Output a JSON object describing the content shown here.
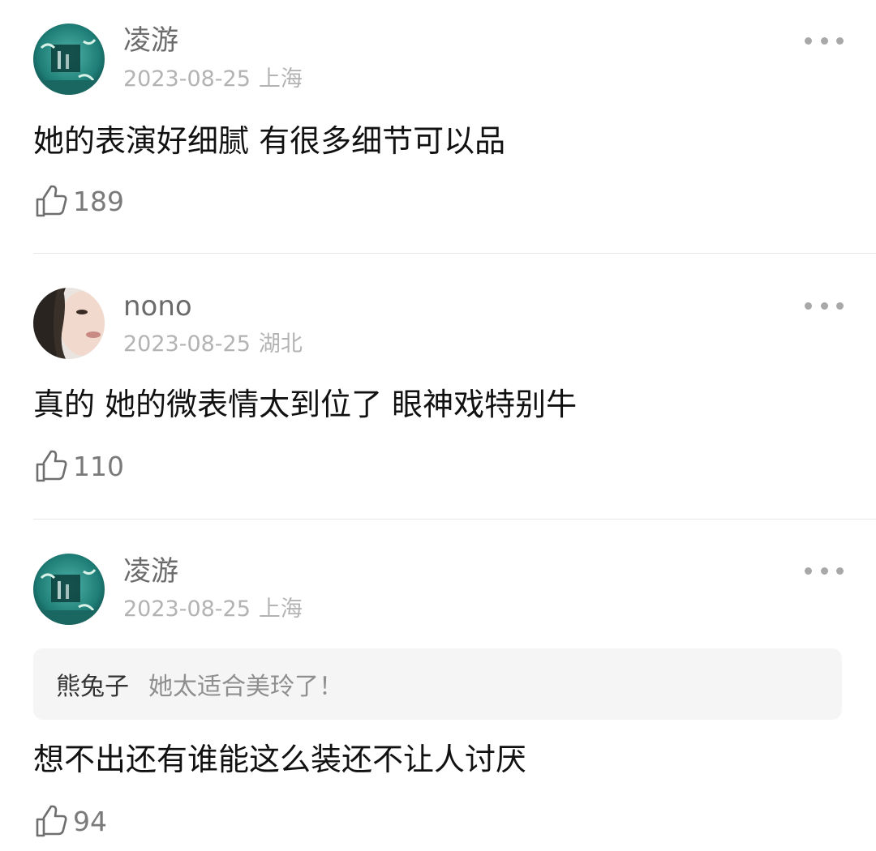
{
  "comments": [
    {
      "username": "凌游",
      "date": "2023-08-25",
      "location": "上海",
      "avatar_icon": "aquarium-avatar-icon",
      "text": "她的表演好细腻 有很多细节可以品",
      "likes": "189"
    },
    {
      "username": "nono",
      "date": "2023-08-25",
      "location": "湖北",
      "avatar_icon": "portrait-avatar-icon",
      "text": "真的 她的微表情太到位了 眼神戏特别牛",
      "likes": "110"
    },
    {
      "username": "凌游",
      "date": "2023-08-25",
      "location": "上海",
      "avatar_icon": "aquarium-avatar-icon",
      "quote": {
        "author": "熊兔子",
        "text": "她太适合美玲了！"
      },
      "text": "想不出还有谁能这么装还不让人讨厌",
      "likes": "94"
    }
  ],
  "icons": {
    "more": "more-dots-icon",
    "like": "thumbs-up-icon"
  },
  "colors": {
    "username": "#6b6b6b",
    "meta": "#b3b3b3",
    "content": "#111111",
    "like_count": "#7a7a7a",
    "divider": "#e6e6e6",
    "quote_background": "#f5f5f5"
  }
}
